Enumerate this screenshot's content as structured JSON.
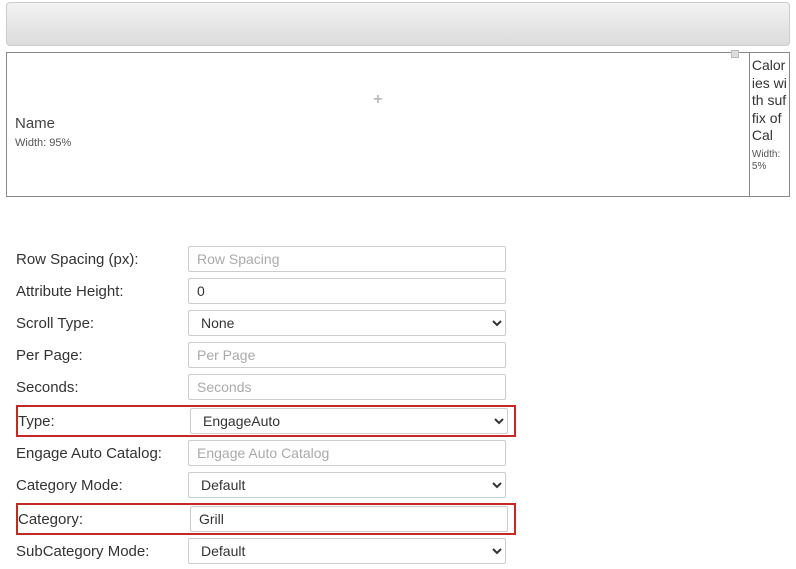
{
  "layout": {
    "col1": {
      "title": "Name",
      "width_label": "Width: 95%"
    },
    "col2": {
      "title": "Calories with suffix of Cal",
      "width_label": "Width:",
      "width_value": "5%"
    },
    "plus": "+"
  },
  "form": {
    "row_spacing": {
      "label": "Row Spacing (px):",
      "placeholder": "Row Spacing",
      "value": ""
    },
    "attr_height": {
      "label": "Attribute Height:",
      "value": "0"
    },
    "scroll_type": {
      "label": "Scroll Type:",
      "selected": "None"
    },
    "per_page": {
      "label": "Per Page:",
      "placeholder": "Per Page",
      "value": ""
    },
    "seconds": {
      "label": "Seconds:",
      "placeholder": "Seconds",
      "value": ""
    },
    "type": {
      "label": "Type:",
      "selected": "EngageAuto"
    },
    "engage_cat": {
      "label": "Engage Auto Catalog:",
      "placeholder": "Engage Auto Catalog",
      "value": ""
    },
    "cat_mode": {
      "label": "Category Mode:",
      "selected": "Default"
    },
    "category": {
      "label": "Category:",
      "value": "Grill"
    },
    "subcat_mode": {
      "label": "SubCategory Mode:",
      "selected": "Default"
    }
  }
}
